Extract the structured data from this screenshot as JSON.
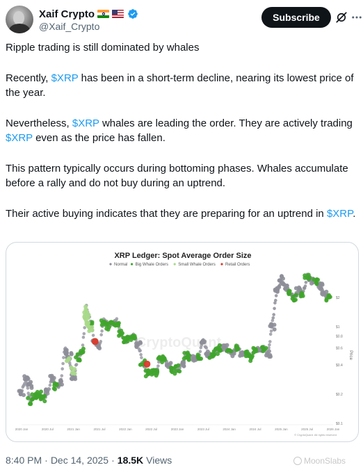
{
  "author": {
    "display_name": "Xaif Crypto",
    "flags": [
      "india-flag",
      "usa-flag"
    ],
    "handle": "@Xaif_Crypto",
    "verified": true
  },
  "actions": {
    "subscribe_label": "Subscribe"
  },
  "tweet": {
    "paragraphs": [
      [
        {
          "t": "Ripple trading is still dominated by whales"
        }
      ],
      [
        {
          "t": "Recently, "
        },
        {
          "t": "$XRP",
          "link": true
        },
        {
          "t": " has been in a short-term decline, nearing its lowest price of the year."
        }
      ],
      [
        {
          "t": "Nevertheless, "
        },
        {
          "t": "$XRP",
          "link": true
        },
        {
          "t": " whales are leading the order. They are actively trading "
        },
        {
          "t": "$XRP",
          "link": true
        },
        {
          "t": " even as the price has fallen."
        }
      ],
      [
        {
          "t": "This pattern typically occurs during bottoming phases. Whales accumulate before a rally and do not buy during an uptrend."
        }
      ],
      [
        {
          "t": "Their active buying indicates that they are preparing for an uptrend in "
        },
        {
          "t": "$XRP",
          "link": true
        },
        {
          "t": "."
        }
      ]
    ]
  },
  "chart": {
    "watermark": "CryptoQuant",
    "copyright": "© CryptoQuant. All rights reserved."
  },
  "chart_data": {
    "type": "scatter",
    "title": "XRP Ledger: Spot Average Order Size",
    "ylabel": "Price",
    "yscale": "log",
    "ylim": [
      0.1,
      3.5
    ],
    "xlim": [
      "2020-01",
      "2026-01"
    ],
    "x_ticks": [
      "2020 Jan",
      "2020 Jul",
      "2021 Jan",
      "2021 Jul",
      "2022 Jan",
      "2022 Jul",
      "2023 Jan",
      "2023 Jul",
      "2024 Jan",
      "2024 Jul",
      "2025 Jan",
      "2025 Jul",
      "2026 Jan"
    ],
    "y_ticks": [
      {
        "value": 0.1,
        "label": "$0.1"
      },
      {
        "value": 0.2,
        "label": "$0.2"
      },
      {
        "value": 0.4,
        "label": "$0.4"
      },
      {
        "value": 0.6,
        "label": "$0.6"
      },
      {
        "value": 0.8,
        "label": "$0.8"
      },
      {
        "value": 1,
        "label": "$1"
      },
      {
        "value": 2,
        "label": "$2"
      }
    ],
    "legend": [
      {
        "name": "Normal",
        "color": "#8e8e99"
      },
      {
        "name": "Big Whale Orders",
        "color": "#3fa52b"
      },
      {
        "name": "Small Whale Orders",
        "color": "#a8d98a"
      },
      {
        "name": "Retail Orders",
        "color": "#d93a2b"
      }
    ],
    "legend_position": "top-center",
    "grid": false,
    "price_path": [
      [
        "2020-01",
        0.21
      ],
      [
        "2020-02",
        0.28
      ],
      [
        "2020-03",
        0.17
      ],
      [
        "2020-04",
        0.19
      ],
      [
        "2020-05",
        0.2
      ],
      [
        "2020-06",
        0.18
      ],
      [
        "2020-07",
        0.2
      ],
      [
        "2020-08",
        0.29
      ],
      [
        "2020-09",
        0.24
      ],
      [
        "2020-10",
        0.25
      ],
      [
        "2020-11",
        0.6
      ],
      [
        "2020-12",
        0.46
      ],
      [
        "2021-01",
        0.28
      ],
      [
        "2021-02",
        0.5
      ],
      [
        "2021-03",
        0.55
      ],
      [
        "2021-04",
        1.6
      ],
      [
        "2021-05",
        1.1
      ],
      [
        "2021-06",
        0.65
      ],
      [
        "2021-07",
        0.6
      ],
      [
        "2021-08",
        1.15
      ],
      [
        "2021-09",
        1.05
      ],
      [
        "2021-10",
        1.05
      ],
      [
        "2021-11",
        1.15
      ],
      [
        "2021-12",
        0.85
      ],
      [
        "2022-01",
        0.7
      ],
      [
        "2022-02",
        0.8
      ],
      [
        "2022-03",
        0.8
      ],
      [
        "2022-04",
        0.65
      ],
      [
        "2022-05",
        0.42
      ],
      [
        "2022-06",
        0.33
      ],
      [
        "2022-07",
        0.34
      ],
      [
        "2022-08",
        0.33
      ],
      [
        "2022-09",
        0.45
      ],
      [
        "2022-10",
        0.46
      ],
      [
        "2022-11",
        0.39
      ],
      [
        "2022-12",
        0.35
      ],
      [
        "2023-01",
        0.38
      ],
      [
        "2023-02",
        0.39
      ],
      [
        "2023-03",
        0.52
      ],
      [
        "2023-04",
        0.48
      ],
      [
        "2023-05",
        0.46
      ],
      [
        "2023-06",
        0.48
      ],
      [
        "2023-07",
        0.75
      ],
      [
        "2023-08",
        0.52
      ],
      [
        "2023-09",
        0.5
      ],
      [
        "2023-10",
        0.55
      ],
      [
        "2023-11",
        0.6
      ],
      [
        "2023-12",
        0.62
      ],
      [
        "2024-01",
        0.55
      ],
      [
        "2024-02",
        0.54
      ],
      [
        "2024-03",
        0.62
      ],
      [
        "2024-04",
        0.5
      ],
      [
        "2024-05",
        0.52
      ],
      [
        "2024-06",
        0.47
      ],
      [
        "2024-07",
        0.58
      ],
      [
        "2024-08",
        0.57
      ],
      [
        "2024-09",
        0.6
      ],
      [
        "2024-10",
        0.52
      ],
      [
        "2024-11",
        1.1
      ],
      [
        "2024-12",
        2.3
      ],
      [
        "2025-01",
        3.0
      ],
      [
        "2025-02",
        2.5
      ],
      [
        "2025-03",
        2.2
      ],
      [
        "2025-04",
        2.0
      ],
      [
        "2025-05",
        2.3
      ],
      [
        "2025-06",
        2.1
      ],
      [
        "2025-07",
        3.3
      ],
      [
        "2025-08",
        3.0
      ],
      [
        "2025-09",
        2.9
      ],
      [
        "2025-10",
        2.5
      ],
      [
        "2025-11",
        2.2
      ],
      [
        "2025-12",
        2.0
      ]
    ],
    "series": [
      {
        "name": "Normal",
        "points": [
          [
            "2020-01",
            0.21
          ],
          [
            "2020-02",
            0.3
          ],
          [
            "2020-03",
            0.25
          ],
          [
            "2020-07",
            0.21
          ],
          [
            "2020-08",
            0.29
          ],
          [
            "2020-10",
            0.26
          ],
          [
            "2020-11",
            0.56
          ],
          [
            "2020-12",
            0.5
          ],
          [
            "2021-01",
            0.3
          ],
          [
            "2021-06",
            0.68
          ],
          [
            "2021-07",
            0.62
          ],
          [
            "2022-04",
            0.66
          ],
          [
            "2022-11",
            0.4
          ],
          [
            "2023-02",
            0.4
          ],
          [
            "2023-05",
            0.47
          ],
          [
            "2023-07",
            0.72
          ],
          [
            "2023-08",
            0.52
          ],
          [
            "2023-12",
            0.6
          ],
          [
            "2024-02",
            0.53
          ],
          [
            "2024-04",
            0.52
          ],
          [
            "2024-08",
            0.56
          ],
          [
            "2024-10",
            0.52
          ],
          [
            "2024-11",
            1.0
          ],
          [
            "2024-12",
            2.4
          ],
          [
            "2025-01",
            3.1
          ],
          [
            "2025-02",
            2.6
          ],
          [
            "2025-05",
            2.4
          ],
          [
            "2025-08",
            3.0
          ],
          [
            "2025-10",
            2.6
          ],
          [
            "2025-11",
            2.3
          ]
        ]
      },
      {
        "name": "Big Whale Orders",
        "points": [
          [
            "2020-03",
            0.17
          ],
          [
            "2020-04",
            0.19
          ],
          [
            "2020-05",
            0.2
          ],
          [
            "2020-06",
            0.18
          ],
          [
            "2020-09",
            0.24
          ],
          [
            "2021-02",
            0.48
          ],
          [
            "2021-03",
            0.56
          ],
          [
            "2021-05",
            1.05
          ],
          [
            "2021-08",
            1.1
          ],
          [
            "2021-09",
            1.0
          ],
          [
            "2021-10",
            1.05
          ],
          [
            "2021-11",
            1.1
          ],
          [
            "2021-12",
            0.85
          ],
          [
            "2022-01",
            0.72
          ],
          [
            "2022-02",
            0.78
          ],
          [
            "2022-03",
            0.8
          ],
          [
            "2022-05",
            0.42
          ],
          [
            "2022-06",
            0.33
          ],
          [
            "2022-07",
            0.34
          ],
          [
            "2022-08",
            0.33
          ],
          [
            "2022-09",
            0.45
          ],
          [
            "2022-10",
            0.46
          ],
          [
            "2022-12",
            0.35
          ],
          [
            "2023-01",
            0.37
          ],
          [
            "2023-03",
            0.5
          ],
          [
            "2023-04",
            0.48
          ],
          [
            "2023-06",
            0.48
          ],
          [
            "2023-09",
            0.5
          ],
          [
            "2023-10",
            0.55
          ],
          [
            "2023-11",
            0.6
          ],
          [
            "2024-01",
            0.55
          ],
          [
            "2024-03",
            0.6
          ],
          [
            "2024-05",
            0.52
          ],
          [
            "2024-06",
            0.47
          ],
          [
            "2024-07",
            0.58
          ],
          [
            "2024-09",
            0.6
          ],
          [
            "2025-03",
            2.2
          ],
          [
            "2025-04",
            2.0
          ],
          [
            "2025-06",
            2.1
          ],
          [
            "2025-07",
            3.2
          ],
          [
            "2025-09",
            2.9
          ],
          [
            "2025-12",
            2.0
          ]
        ]
      },
      {
        "name": "Small Whale Orders",
        "points": [
          [
            "2020-12",
            0.45
          ],
          [
            "2021-01",
            0.35
          ],
          [
            "2021-04",
            1.5
          ],
          [
            "2021-04",
            1.3
          ],
          [
            "2021-04",
            1.1
          ],
          [
            "2021-05",
            0.95
          ]
        ]
      },
      {
        "name": "Retail Orders",
        "points": [
          [
            "2021-06",
            0.7
          ],
          [
            "2022-06",
            0.41
          ]
        ]
      }
    ]
  },
  "footer": {
    "time": "8:40 PM",
    "separator": "·",
    "date": "Dec 14, 2025",
    "views": "18.5K",
    "views_label": "Views"
  },
  "overlay": {
    "watermark": "MoonSlabs"
  }
}
